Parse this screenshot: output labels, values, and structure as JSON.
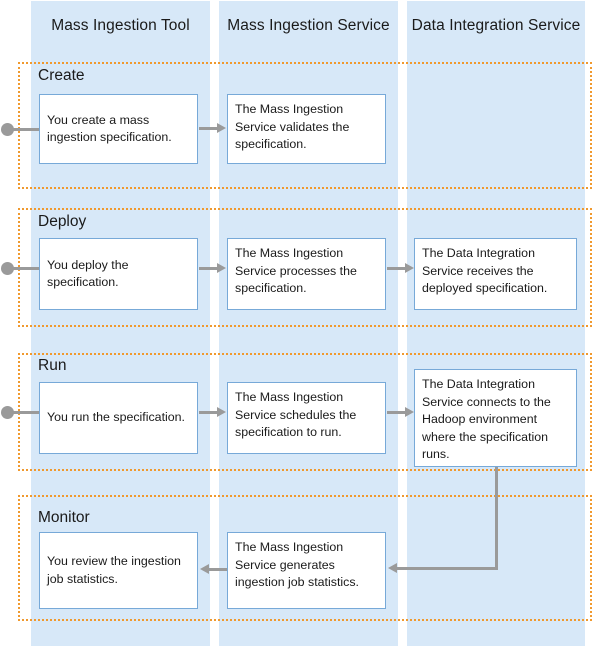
{
  "diagram": {
    "title": "Mass Ingestion process swimlane diagram",
    "colors": {
      "lane_bg": "#d7e8f8",
      "phase_border": "#f0992e",
      "box_border": "#77a9d8",
      "box_bg": "#ffffff",
      "connector": "#9a9a9a"
    }
  },
  "lanes": [
    {
      "id": "mass-ingestion-tool",
      "label": "Mass Ingestion Tool"
    },
    {
      "id": "mass-ingestion-service",
      "label": "Mass Ingestion Service"
    },
    {
      "id": "data-integration-service",
      "label": "Data Integration Service"
    }
  ],
  "phases": [
    {
      "id": "create",
      "label": "Create",
      "steps": [
        {
          "lane": "mass-ingestion-tool",
          "text": "You create a mass ingestion specification."
        },
        {
          "lane": "mass-ingestion-service",
          "text": "The Mass Ingestion Service validates the specification."
        }
      ]
    },
    {
      "id": "deploy",
      "label": "Deploy",
      "steps": [
        {
          "lane": "mass-ingestion-tool",
          "text": "You deploy the specification."
        },
        {
          "lane": "mass-ingestion-service",
          "text": "The Mass Ingestion Service processes the specification."
        },
        {
          "lane": "data-integration-service",
          "text": "The Data Integration Service receives the deployed specification."
        }
      ]
    },
    {
      "id": "run",
      "label": "Run",
      "steps": [
        {
          "lane": "mass-ingestion-tool",
          "text": "You run the specification."
        },
        {
          "lane": "mass-ingestion-service",
          "text": "The Mass Ingestion Service schedules the specification to run."
        },
        {
          "lane": "data-integration-service",
          "text": "The Data Integration Service connects to the Hadoop environment where the specification runs."
        }
      ]
    },
    {
      "id": "monitor",
      "label": "Monitor",
      "steps": [
        {
          "lane": "mass-ingestion-tool",
          "text": "You review the ingestion job statistics."
        },
        {
          "lane": "mass-ingestion-service",
          "text": "The Mass Ingestion Service generates ingestion job statistics."
        }
      ]
    }
  ]
}
